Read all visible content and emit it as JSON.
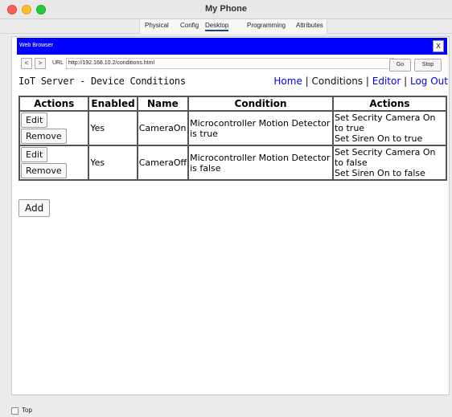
{
  "window": {
    "title": "My Phone"
  },
  "tabs": [
    {
      "label": "Physical"
    },
    {
      "label": "Config"
    },
    {
      "label": "Desktop"
    },
    {
      "label": "Programming"
    },
    {
      "label": "Attributes"
    }
  ],
  "browser": {
    "title": "Web Browser",
    "close_label": "X",
    "back_label": "<",
    "forward_label": ">",
    "url_label": "URL",
    "url": "http://192.168.10.2/conditions.html",
    "go_label": "Go",
    "stop_label": "Stop"
  },
  "page": {
    "title": "IoT Server - Device Conditions",
    "nav": {
      "home": "Home",
      "conditions": "Conditions",
      "editor": "Editor",
      "logout": "Log Out",
      "sep": "|"
    },
    "table": {
      "headers": [
        "Actions",
        "Enabled",
        "Name",
        "Condition",
        "Actions"
      ],
      "rows": [
        {
          "edit": "Edit",
          "remove": "Remove",
          "enabled": "Yes",
          "name": "CameraOn",
          "condition": "Microcontroller Motion Detector is true",
          "action1": "Set Secrity Camera On to true",
          "action2": "Set Siren On to true"
        },
        {
          "edit": "Edit",
          "remove": "Remove",
          "enabled": "Yes",
          "name": "CameraOff",
          "condition": "Microcontroller Motion Detector is false",
          "action1": "Set Secrity Camera On to false",
          "action2": "Set Siren On to false"
        }
      ]
    },
    "add_label": "Add"
  },
  "footer": {
    "top_label": "Top"
  },
  "colors": {
    "browser_bar": "#0000ff",
    "link": "#0000ee",
    "active_tab_underline": "#1f3f8f"
  }
}
